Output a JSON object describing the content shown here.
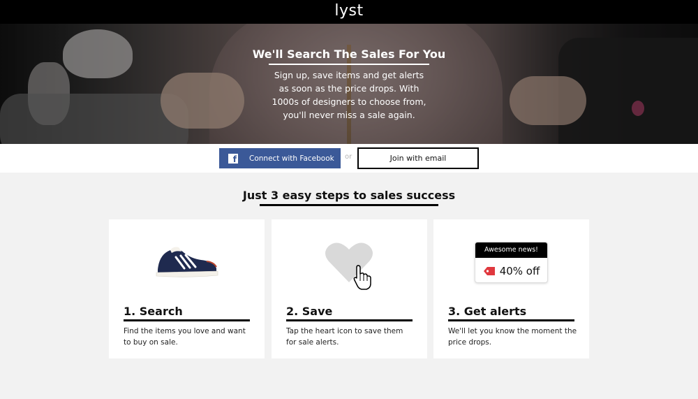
{
  "header": {
    "logo": "lyst"
  },
  "hero": {
    "title": "We'll Search The Sales For You",
    "text": "Sign up, save items and get alerts as soon as the price drops. With 1000s of designers to choose from, you'll never miss a sale again."
  },
  "signup": {
    "facebook_label": "Connect with Facebook",
    "or_label": "or",
    "email_label": "Join with email"
  },
  "steps": {
    "title": "Just 3 easy steps to sales success",
    "items": [
      {
        "title": "1. Search",
        "text": "Find the items you love and want to buy on sale.",
        "icon": "sneaker-icon"
      },
      {
        "title": "2. Save",
        "text": "Tap the heart icon to save them for sale alerts.",
        "icon": "heart-icon"
      },
      {
        "title": "3. Get alerts",
        "text": "We'll let you know the moment the price drops.",
        "icon": "alert-icon"
      }
    ],
    "alert": {
      "header": "Awesome news!",
      "discount": "40% off"
    }
  },
  "colors": {
    "facebook": "#3b5998",
    "tag": "#e0383e",
    "heart": "#d9d9d9",
    "shoe": "#1f2a4f"
  }
}
